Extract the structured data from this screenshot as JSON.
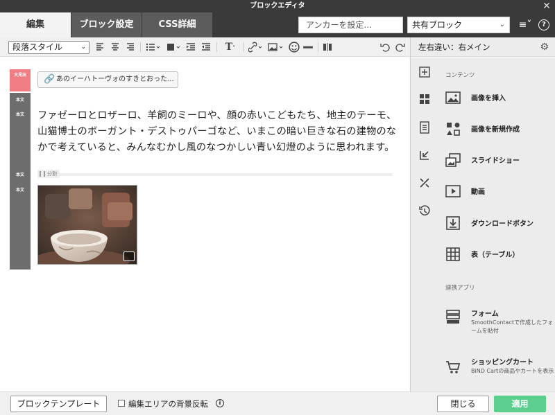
{
  "window": {
    "title": "ブロックエディタ"
  },
  "tabs": [
    {
      "label": "編集"
    },
    {
      "label": "ブロック設定"
    },
    {
      "label": "CSS詳細"
    }
  ],
  "anchor": {
    "placeholder": "アンカーを設定..."
  },
  "shared_block": {
    "selected": "共有ブロック"
  },
  "toolbar": {
    "paragraph_style": "段落スタイル",
    "icons": [
      "align-left-icon",
      "align-center-icon",
      "align-right-icon",
      "list-icon",
      "block-icon",
      "indent-icon",
      "outdent-icon",
      "text-format-icon",
      "link-icon",
      "image-icon",
      "emoji-icon",
      "hr-icon",
      "split-icon",
      "undo-icon",
      "redo-icon"
    ]
  },
  "editor": {
    "gutter": {
      "heading_label": "大見出",
      "body_label": "本文"
    },
    "anchor_button": "あのイーハトーヴォのすきとおった...",
    "paragraph": "ファゼーロとロザーロ、羊飼のミーロや、顔の赤いこどもたち、地主のテーモ、山猫博士のボーガント・デストゥパーゴなど、いまこの暗い巨きな石の建物のなかで考えていると、みんなむかし風のなつかしい青い幻燈のように思われます。",
    "divider_label": "分割"
  },
  "right_panel": {
    "title": "左右違い：右メイン",
    "contents_title": "コンテンツ",
    "items": [
      {
        "label": "画像を挿入",
        "icon": "image-icon"
      },
      {
        "label": "画像を新規作成",
        "icon": "shapes-icon"
      },
      {
        "label": "スライドショー",
        "icon": "slideshow-icon"
      },
      {
        "label": "動画",
        "icon": "video-icon"
      },
      {
        "label": "ダウンロードボタン",
        "icon": "download-icon"
      },
      {
        "label": "表（テーブル）",
        "icon": "table-icon"
      }
    ],
    "apps_title": "連携アプリ",
    "apps": [
      {
        "label": "フォーム",
        "desc": "SmoothContactで作成したフォームを貼付",
        "icon": "form-icon"
      },
      {
        "label": "ショッピングカート",
        "desc": "BiND Cartの商品やカートを表示",
        "icon": "cart-icon"
      }
    ]
  },
  "footer": {
    "template_button": "ブロックテンプレート",
    "invert_label": "編集エリアの背景反転",
    "close_button": "閉じる",
    "apply_button": "適用"
  },
  "colors": {
    "apply": "#5ccf8e",
    "heading_marker": "#f07c84",
    "body_marker": "#6d6d6d"
  }
}
